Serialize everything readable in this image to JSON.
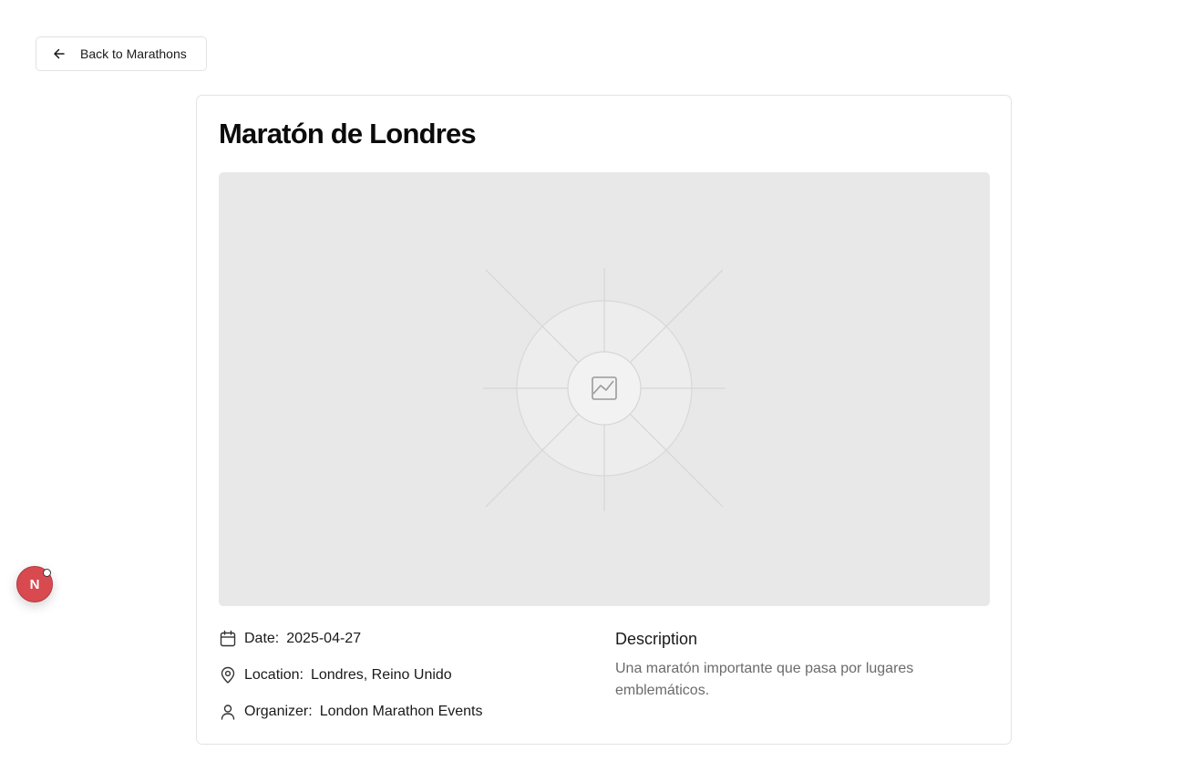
{
  "back_button": {
    "label": "Back to Marathons",
    "icon": "arrow-left-icon"
  },
  "marathon": {
    "title": "Maratón de Londres",
    "image": {
      "icon": "image-placeholder-icon"
    },
    "details": {
      "date": {
        "label": "Date:",
        "value": "2025-04-27",
        "icon": "calendar-icon"
      },
      "location": {
        "label": "Location:",
        "value": "Londres, Reino Unido",
        "icon": "map-pin-icon"
      },
      "organizer": {
        "label": "Organizer:",
        "value": "London Marathon Events",
        "icon": "user-icon"
      }
    },
    "description": {
      "heading": "Description",
      "text": "Una maratón importante que pasa por lugares emblemáticos."
    }
  },
  "dev_badge": {
    "letter": "N",
    "color": "#d94a50"
  }
}
